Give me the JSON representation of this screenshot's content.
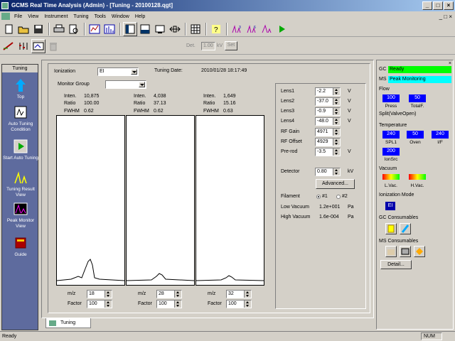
{
  "window": {
    "title": "GCMS Real Time Analysis (Admin) - [Tuning - 20100128.qgt]",
    "buttons": [
      "_",
      "□",
      "×"
    ]
  },
  "menu": [
    "File",
    "View",
    "Instrument",
    "Tuning",
    "Tools",
    "Window",
    "Help"
  ],
  "toolbar2": {
    "det_label": "Det.",
    "det_value": "1.00",
    "kv_label": "kV",
    "set_label": "Set"
  },
  "sidebar": {
    "title": "Tuning",
    "items": [
      {
        "label": "Top"
      },
      {
        "label": "Auto Tuning Condition"
      },
      {
        "label": "Start Auto Tuning"
      },
      {
        "label": "Tuning Result View"
      },
      {
        "label": "Peak Monitor View"
      },
      {
        "label": "Guide"
      }
    ]
  },
  "tuning": {
    "ionization_label": "Ionization",
    "ionization_value": "EI",
    "date_label": "Tuning Date:",
    "date_value": "2010/01/28 18:17:49",
    "monitor_group_label": "Monitor Group",
    "monitor_group_value": "",
    "peaks": [
      {
        "inten": "10,875",
        "ratio": "100.00",
        "fwhm": "0.62",
        "mz": "18",
        "factor": "100"
      },
      {
        "inten": "4,038",
        "ratio": "37.13",
        "fwhm": "0.62",
        "mz": "28",
        "factor": "100"
      },
      {
        "inten": "1,649",
        "ratio": "15.16",
        "fwhm": "0.63",
        "mz": "32",
        "factor": "100"
      }
    ],
    "inten_label": "Inten.",
    "ratio_label": "Ratio",
    "fwhm_label": "FWHM",
    "mz_label": "m/z",
    "factor_label": "Factor",
    "params": [
      {
        "label": "Lens1",
        "value": "-2.2",
        "unit": "V"
      },
      {
        "label": "Lens2",
        "value": "-37.0",
        "unit": "V"
      },
      {
        "label": "Lens3",
        "value": "-0.9",
        "unit": "V"
      },
      {
        "label": "Lens4",
        "value": "-48.0",
        "unit": "V"
      },
      {
        "label": "RF Gain",
        "value": "4971",
        "unit": ""
      },
      {
        "label": "RF Offset",
        "value": "4929",
        "unit": ""
      },
      {
        "label": "Pre-rod",
        "value": "-3.5",
        "unit": "V"
      }
    ],
    "detector_label": "Detector",
    "detector_value": "0.80",
    "detector_unit": "kV",
    "advanced_label": "Advanced...",
    "filament_label": "Filament",
    "filament_options": [
      "#1",
      "#2"
    ],
    "filament_selected": "#1",
    "low_vac_label": "Low Vacuum",
    "low_vac_value": "1.2e+001",
    "low_vac_unit": "Pa",
    "high_vac_label": "High Vacuum",
    "high_vac_value": "1.6e-004",
    "high_vac_unit": "Pa",
    "tab_label": "Tuning"
  },
  "status_panel": {
    "gc_label": "GC",
    "gc_status": "Ready",
    "gc_color": "#00ff00",
    "ms_label": "MS",
    "ms_status": "Peak Monitoring",
    "ms_color": "#00ffff",
    "flow_label": "Flow",
    "press_value": "100",
    "press_label": "Press",
    "totalf_value": "50",
    "totalf_label": "TotalF.",
    "split_label": "Split(ValveOpen)",
    "temp_label": "Temperature",
    "spl1_value": "240",
    "spl1_label": "SPL1",
    "oven_value": "50",
    "oven_label": "Oven",
    "if_value": "240",
    "if_label": "I/F",
    "ionsrc_value": "200",
    "ionsrc_label": "IonSrc",
    "vacuum_label": "Vacuum",
    "lvac_label": "L.Vac.",
    "hvac_label": "H.Vac.",
    "ion_mode_label": "Ionization Mode",
    "ion_mode_value": "EI",
    "gc_consumables_label": "GC Consumables",
    "ms_consumables_label": "MS Consumables",
    "detail_label": "Detail..."
  },
  "statusbar": {
    "left": "Ready",
    "num": "NUM"
  }
}
